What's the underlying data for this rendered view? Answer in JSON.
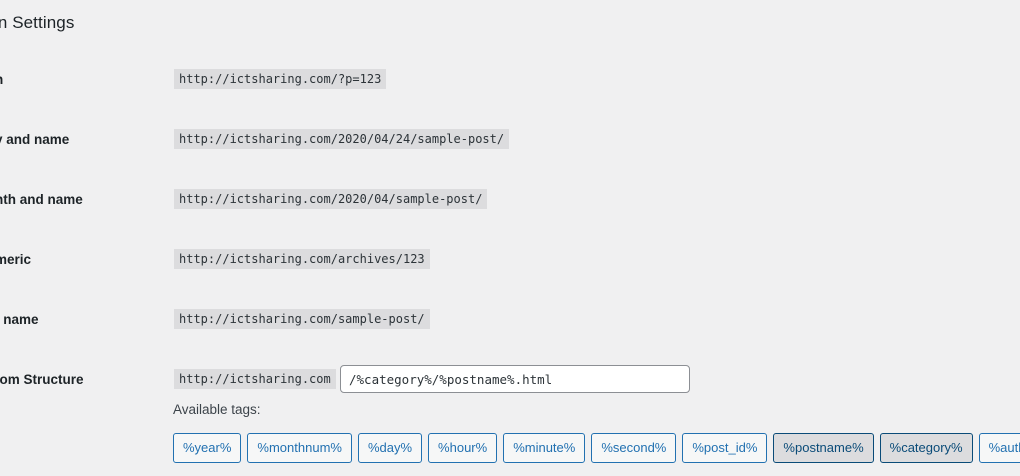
{
  "section": {
    "title": "mon Settings"
  },
  "rows": [
    {
      "label": "n",
      "example": "http://ictsharing.com/?p=123"
    },
    {
      "label": "y and name",
      "example": "http://ictsharing.com/2020/04/24/sample-post/"
    },
    {
      "label": "nth and name",
      "example": "http://ictsharing.com/2020/04/sample-post/"
    },
    {
      "label": "meric",
      "example": "http://ictsharing.com/archives/123"
    },
    {
      "label": "t name",
      "example": "http://ictsharing.com/sample-post/"
    }
  ],
  "custom": {
    "label": "tom Structure",
    "prefix": "http://ictsharing.com",
    "value": "/%category%/%postname%.html"
  },
  "available_tags_label": "Available tags:",
  "tags": [
    {
      "label": "%year%",
      "active": false
    },
    {
      "label": "%monthnum%",
      "active": false
    },
    {
      "label": "%day%",
      "active": false
    },
    {
      "label": "%hour%",
      "active": false
    },
    {
      "label": "%minute%",
      "active": false
    },
    {
      "label": "%second%",
      "active": false
    },
    {
      "label": "%post_id%",
      "active": false
    },
    {
      "label": "%postname%",
      "active": true
    },
    {
      "label": "%category%",
      "active": true
    },
    {
      "label": "%auth",
      "active": false
    }
  ],
  "colors": {
    "background": "#f0f0f1",
    "code_background": "#dcdcde",
    "accent": "#2271b1"
  }
}
